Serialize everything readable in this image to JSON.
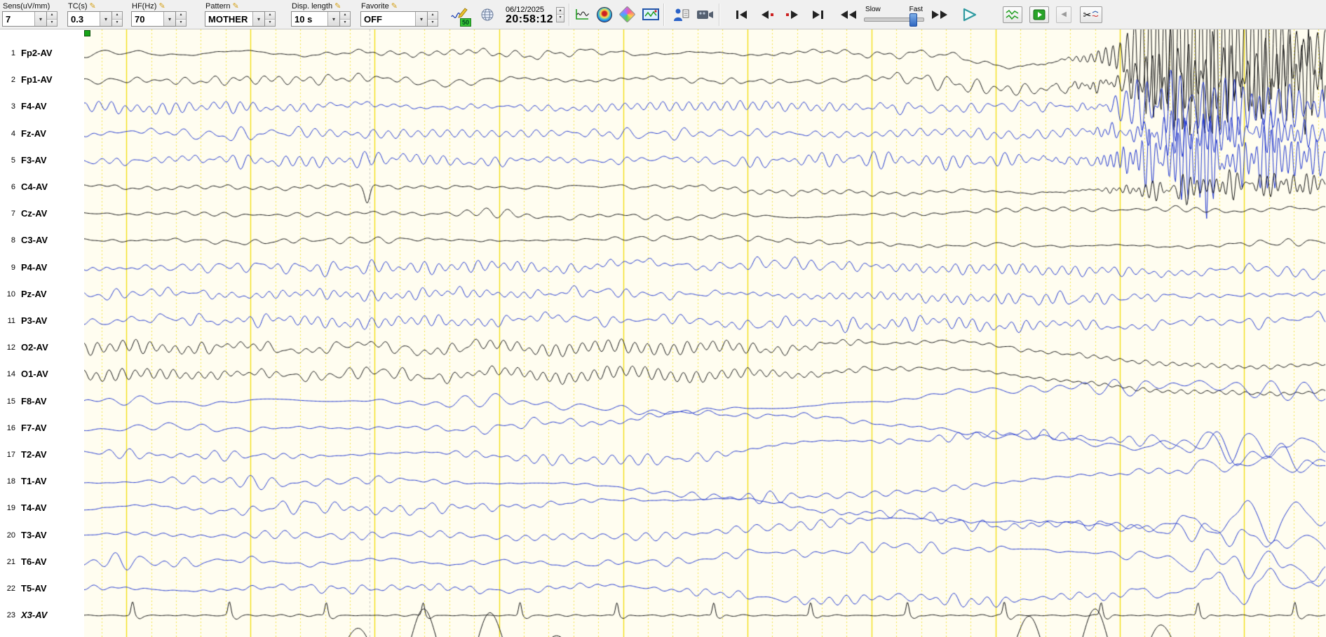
{
  "toolbar": {
    "sens": {
      "label": "Sens(uV/mm)",
      "value": "7"
    },
    "tc": {
      "label": "TC(s)",
      "value": "0.3"
    },
    "hf": {
      "label": "HF(Hz)",
      "value": "70"
    },
    "pattern": {
      "label": "Pattern",
      "value": "MOTHER"
    },
    "disp": {
      "label": "Disp. length",
      "value": "10 s"
    },
    "favorite": {
      "label": "Favorite",
      "value": "OFF"
    },
    "notch_badge": "50",
    "date": "06/12/2025",
    "time": "20:58:12",
    "slider": {
      "slow": "Slow",
      "fast": "Fast"
    }
  },
  "icons": {
    "pencil": "✎",
    "combo_arrow": "▾",
    "spin_up": "▴",
    "spin_down": "▾",
    "scissors": "✂",
    "back_arrow": "◀"
  },
  "eeg": {
    "seconds": 10,
    "channels": [
      {
        "num": "1",
        "label": "Fp2-AV",
        "color": "black"
      },
      {
        "num": "2",
        "label": "Fp1-AV",
        "color": "black"
      },
      {
        "num": "3",
        "label": "F4-AV",
        "color": "blue"
      },
      {
        "num": "4",
        "label": "Fz-AV",
        "color": "blue"
      },
      {
        "num": "5",
        "label": "F3-AV",
        "color": "blue"
      },
      {
        "num": "6",
        "label": "C4-AV",
        "color": "black"
      },
      {
        "num": "7",
        "label": "Cz-AV",
        "color": "black"
      },
      {
        "num": "8",
        "label": "C3-AV",
        "color": "black"
      },
      {
        "num": "9",
        "label": "P4-AV",
        "color": "blue"
      },
      {
        "num": "10",
        "label": "Pz-AV",
        "color": "blue"
      },
      {
        "num": "11",
        "label": "P3-AV",
        "color": "blue"
      },
      {
        "num": "12",
        "label": "O2-AV",
        "color": "black"
      },
      {
        "num": "14",
        "label": "O1-AV",
        "color": "black"
      },
      {
        "num": "15",
        "label": "F8-AV",
        "color": "blue"
      },
      {
        "num": "16",
        "label": "F7-AV",
        "color": "blue"
      },
      {
        "num": "17",
        "label": "T2-AV",
        "color": "blue"
      },
      {
        "num": "18",
        "label": "T1-AV",
        "color": "blue"
      },
      {
        "num": "19",
        "label": "T4-AV",
        "color": "blue"
      },
      {
        "num": "20",
        "label": "T3-AV",
        "color": "blue"
      },
      {
        "num": "21",
        "label": "T6-AV",
        "color": "blue"
      },
      {
        "num": "22",
        "label": "T5-AV",
        "color": "blue"
      },
      {
        "num": "23",
        "label": "X3-AV",
        "color": "black",
        "italic": true
      }
    ]
  },
  "colors": {
    "paper": "#fffdf0",
    "grid": "#f0dc00",
    "trace_black": "#151515",
    "trace_blue": "#2238d0",
    "accent_green": "#17a317"
  }
}
